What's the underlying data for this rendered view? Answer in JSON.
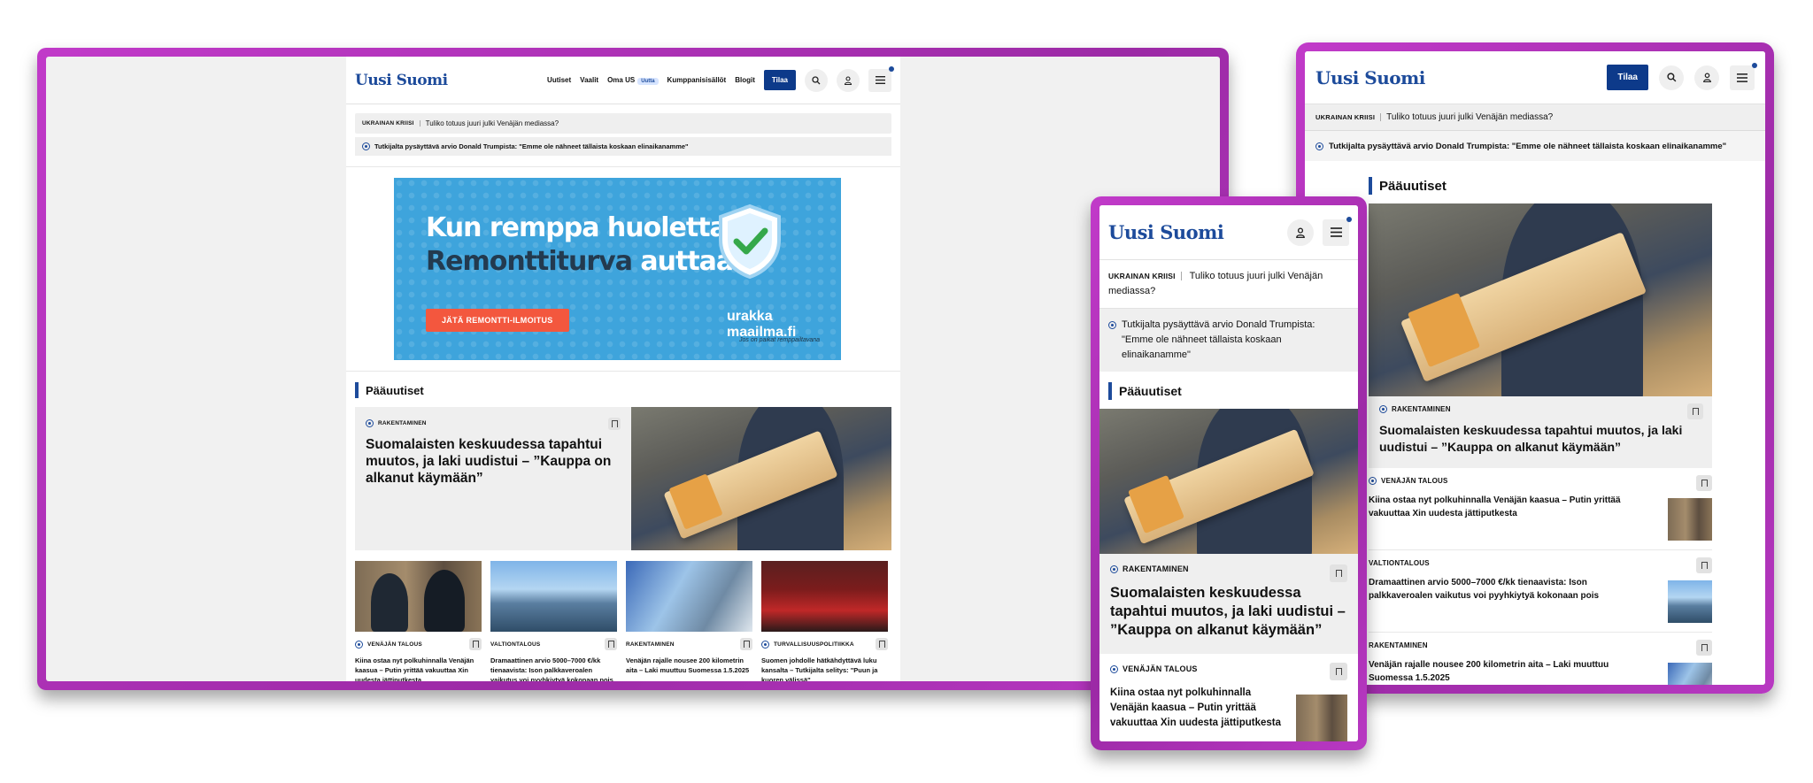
{
  "site": {
    "logo": "Uusi Suomi",
    "nav": [
      "Uutiset",
      "Vaalit",
      "Oma US",
      "Kumppanisisällöt",
      "Blogit"
    ],
    "new_badge": "Uutta",
    "subscribe": "Tilaa"
  },
  "ticker": {
    "label": "UKRAINAN KRIISI",
    "headline": "Tuliko totuus juuri julki Venäjän mediassa?"
  },
  "live": {
    "headline": "Tutkijalta pysäyttävä arvio Donald Trumpista: \"Emme ole nähneet tällaista koskaan elinaikanamme\""
  },
  "ad": {
    "line1": "Kun remppa huolettaa,",
    "line2_dark": "Remonttiturva",
    "line2_light": " auttaa",
    "cta": "JÄTÄ REMONTTI-ILMOITUS",
    "brand": "urakka maailma.fi",
    "tagline": "Jos on paikat remppailtavana"
  },
  "section": {
    "title": "Pääuutiset"
  },
  "lead": {
    "category": "RAKENTAMINEN",
    "title": "Suomalaisten keskuudessa tapahtui muutos, ja laki uudistui – ”Kauppa on alkanut käymään”"
  },
  "cards": [
    {
      "category": "VENÄJÄN TALOUS",
      "title": "Kiina ostaa nyt polkuhinnalla Venäjän kaasua – Putin yrittää vakuuttaa Xin uudesta jättiputkesta"
    },
    {
      "category": "VALTIONTALOUS",
      "title": "Dramaattinen arvio 5000–7000 €/kk tienaavista: Ison palkkaveroalen vaikutus voi pyyhkiytyä kokonaan pois"
    },
    {
      "category": "RAKENTAMINEN",
      "title": "Venäjän rajalle nousee 200 kilometrin aita – Laki muuttuu Suomessa 1.5.2025"
    },
    {
      "category": "TURVALLISUUSPOLITIIKKA",
      "title": "Suomen johdolle hätkähdyttävä luku kansalta – Tutkijalta selitys: \"Puun ja kuoren välissä\""
    }
  ],
  "colors": {
    "brand_blue": "#1d4b9b",
    "subscribe_bg": "#0d3a8a",
    "frame": "#b338be",
    "ad_bg": "#3ea4dc",
    "ad_cta": "#f3573e"
  },
  "icons": [
    "search-icon",
    "user-icon",
    "menu-icon",
    "bookmark-icon",
    "live-icon"
  ]
}
